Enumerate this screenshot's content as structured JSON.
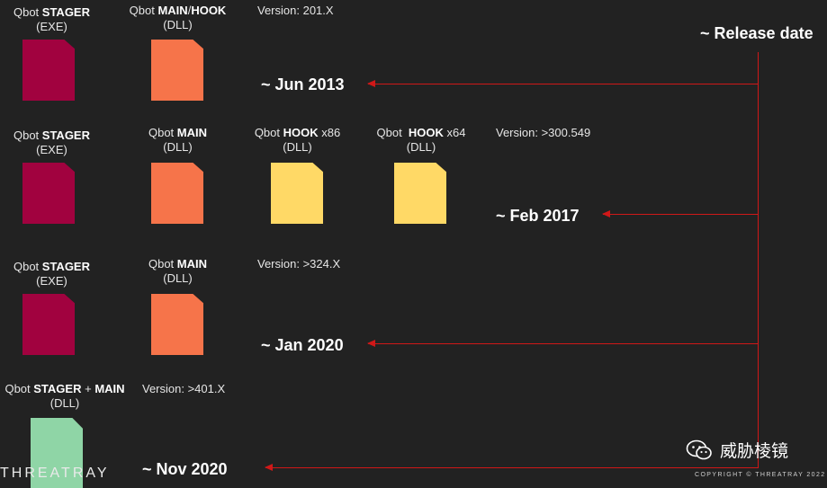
{
  "colors": {
    "stager_exe": "#a1023f",
    "main_dll": "#f6744a",
    "hook_dll": "#ffd966",
    "stager_main_dll": "#8fd5a6",
    "arrow": "#d01818",
    "background": "#222222"
  },
  "header": {
    "release_date": "~ Release date"
  },
  "rows": [
    {
      "files": [
        {
          "name_pre": "Qbot ",
          "name_bold": "STAGER",
          "name_post": "",
          "type": "(EXE)"
        },
        {
          "name_pre": "Qbot ",
          "name_bold": "MAIN",
          "name_mid": "/",
          "name_bold2": "HOOK",
          "type": "(DLL)"
        }
      ],
      "version": "Version: 201.X",
      "date": "~ Jun 2013"
    },
    {
      "files": [
        {
          "name_pre": "Qbot ",
          "name_bold": "STAGER",
          "type": "(EXE)"
        },
        {
          "name_pre": "Qbot ",
          "name_bold": "MAIN",
          "type": "(DLL)"
        },
        {
          "name_pre": "Qbot ",
          "name_bold": "HOOK",
          "name_post": " x86",
          "type": "(DLL)"
        },
        {
          "name_pre": "Qbot  ",
          "name_bold": "HOOK",
          "name_post": " x64",
          "type": "(DLL)"
        }
      ],
      "version": "Version: >300.549",
      "date": "~ Feb 2017"
    },
    {
      "files": [
        {
          "name_pre": "Qbot ",
          "name_bold": "STAGER",
          "type": "(EXE)"
        },
        {
          "name_pre": "Qbot ",
          "name_bold": "MAIN",
          "type": "(DLL)"
        }
      ],
      "version": "Version: >324.X",
      "date": "~ Jan 2020"
    },
    {
      "files": [
        {
          "name_pre": "Qbot ",
          "name_bold": "STAGER",
          "name_mid": " + ",
          "name_bold2": "MAIN",
          "type": "(DLL)"
        }
      ],
      "version": "Version: >401.X",
      "date": "~ Nov 2020"
    }
  ],
  "footer": {
    "brand": "THREATRAY",
    "copyright": "COPYRIGHT © THREATRAY 2022",
    "wechat_label": "威胁棱镜",
    "wechat_icon": "wechat-icon"
  }
}
